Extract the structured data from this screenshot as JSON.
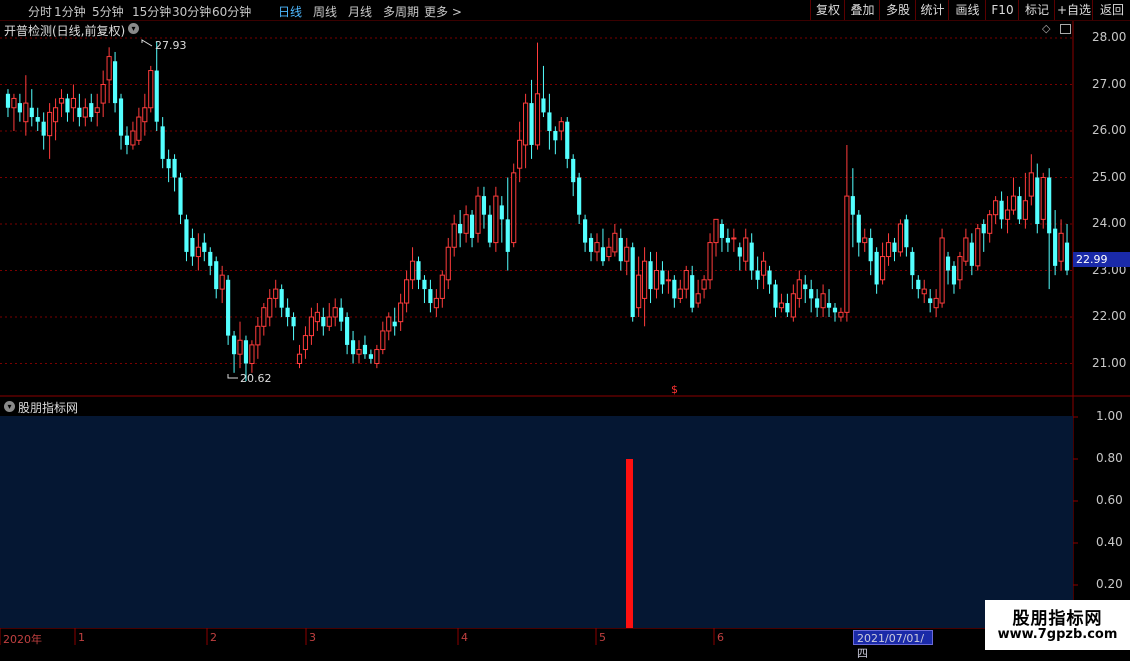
{
  "periods": [
    "分时",
    "1分钟",
    "5分钟",
    "15分钟",
    "30分钟",
    "60分钟",
    "日线",
    "周线",
    "月线",
    "多周期",
    "更多 >"
  ],
  "active_period": "日线",
  "toolbar": [
    "复权",
    "叠加",
    "多股",
    "统计",
    "画线",
    "F10",
    "标记",
    "+自选",
    "返回"
  ],
  "main_title": "开普检测(日线,前复权)",
  "high_label": "27.93",
  "low_label": "20.62",
  "last_price": "22.99",
  "price_axis": [
    "28.00",
    "27.00",
    "26.00",
    "25.00",
    "24.00",
    "23.00",
    "22.00",
    "21.00"
  ],
  "indicator_title": "股朋指标网",
  "indicator_axis": [
    "1.00",
    "0.80",
    "0.60",
    "0.40",
    "0.20"
  ],
  "x_labels": [
    "2020年",
    "1",
    "2",
    "3",
    "4",
    "5",
    "6"
  ],
  "date_box": "2021/07/01/四",
  "marker": "$",
  "watermark": {
    "name": "股朋指标网",
    "url": "www.7gpzb.com"
  },
  "colors": {
    "up": "#ff3c3c",
    "down": "#54ffff",
    "bg": "#000000",
    "panel": "#051733",
    "grid": "#7a0000",
    "signal": "#ff1010"
  },
  "indicator_signal": {
    "value": 0.8
  },
  "chart_data": {
    "type": "candlestick",
    "ylim": [
      20.5,
      28.3
    ],
    "candles": [
      [
        26.8,
        26.5,
        26.9,
        26.3
      ],
      [
        26.5,
        26.7,
        26.8,
        26.0
      ],
      [
        26.6,
        26.4,
        26.8,
        26.2
      ],
      [
        26.2,
        26.6,
        27.2,
        25.9
      ],
      [
        26.5,
        26.3,
        26.9,
        26.1
      ],
      [
        26.3,
        26.2,
        26.5,
        26.0
      ],
      [
        26.2,
        25.9,
        26.4,
        25.6
      ],
      [
        25.9,
        26.4,
        26.6,
        25.4
      ],
      [
        26.2,
        26.5,
        26.7,
        25.8
      ],
      [
        26.6,
        26.7,
        26.9,
        26.3
      ],
      [
        26.7,
        26.4,
        26.8,
        26.2
      ],
      [
        26.5,
        26.7,
        27.0,
        26.2
      ],
      [
        26.5,
        26.3,
        26.8,
        26.1
      ],
      [
        26.3,
        26.5,
        26.7,
        26.1
      ],
      [
        26.6,
        26.3,
        26.8,
        26.2
      ],
      [
        26.4,
        26.5,
        26.8,
        26.1
      ],
      [
        26.6,
        27.0,
        27.3,
        26.3
      ],
      [
        27.1,
        27.6,
        27.8,
        26.6
      ],
      [
        27.5,
        26.6,
        27.7,
        26.4
      ],
      [
        26.7,
        25.9,
        26.8,
        25.6
      ],
      [
        25.9,
        25.7,
        26.1,
        25.5
      ],
      [
        25.7,
        26.0,
        26.2,
        25.6
      ],
      [
        25.8,
        26.3,
        26.5,
        25.7
      ],
      [
        26.2,
        26.5,
        26.8,
        25.9
      ],
      [
        26.5,
        27.3,
        27.4,
        26.4
      ],
      [
        27.3,
        26.2,
        27.93,
        26.0
      ],
      [
        26.1,
        25.4,
        26.3,
        25.2
      ],
      [
        25.4,
        25.2,
        25.6,
        24.9
      ],
      [
        25.4,
        25.0,
        25.5,
        24.7
      ],
      [
        25.0,
        24.2,
        25.1,
        24.0
      ],
      [
        24.1,
        23.4,
        24.2,
        23.2
      ],
      [
        23.7,
        23.3,
        23.9,
        23.1
      ],
      [
        23.3,
        23.5,
        23.8,
        23.0
      ],
      [
        23.6,
        23.4,
        23.8,
        23.2
      ],
      [
        23.4,
        23.1,
        23.5,
        22.9
      ],
      [
        23.2,
        22.6,
        23.3,
        22.4
      ],
      [
        22.6,
        22.9,
        23.1,
        22.3
      ],
      [
        22.8,
        21.6,
        22.9,
        21.4
      ],
      [
        21.6,
        21.2,
        21.7,
        20.8
      ],
      [
        21.2,
        21.5,
        21.9,
        20.9
      ],
      [
        21.5,
        21.0,
        21.6,
        20.62
      ],
      [
        21.0,
        21.4,
        21.5,
        20.8
      ],
      [
        21.4,
        21.8,
        22.0,
        21.1
      ],
      [
        21.8,
        22.2,
        22.3,
        21.6
      ],
      [
        22.0,
        22.4,
        22.6,
        21.8
      ],
      [
        22.4,
        22.6,
        22.8,
        22.2
      ],
      [
        22.6,
        22.2,
        22.7,
        22.0
      ],
      [
        22.2,
        22.0,
        22.4,
        21.8
      ],
      [
        22.0,
        21.8,
        22.1,
        21.5
      ],
      [
        21.0,
        21.2,
        21.4,
        20.9
      ],
      [
        21.3,
        21.6,
        21.8,
        21.1
      ],
      [
        21.6,
        22.0,
        22.2,
        21.4
      ],
      [
        21.9,
        22.1,
        22.3,
        21.7
      ],
      [
        22.0,
        21.8,
        22.2,
        21.6
      ],
      [
        21.8,
        22.0,
        22.3,
        21.7
      ],
      [
        22.0,
        22.2,
        22.4,
        21.8
      ],
      [
        22.2,
        21.9,
        22.4,
        21.7
      ],
      [
        22.0,
        21.4,
        22.1,
        21.2
      ],
      [
        21.5,
        21.2,
        21.7,
        21.0
      ],
      [
        21.2,
        21.3,
        21.5,
        21.0
      ],
      [
        21.4,
        21.2,
        21.6,
        21.1
      ],
      [
        21.2,
        21.1,
        21.3,
        21.0
      ],
      [
        21.0,
        21.3,
        21.4,
        20.9
      ],
      [
        21.3,
        21.7,
        21.9,
        21.2
      ],
      [
        21.7,
        22.0,
        22.1,
        21.5
      ],
      [
        21.9,
        21.8,
        22.2,
        21.6
      ],
      [
        21.9,
        22.3,
        22.5,
        21.7
      ],
      [
        22.3,
        22.8,
        23.0,
        22.1
      ],
      [
        22.8,
        23.2,
        23.5,
        22.6
      ],
      [
        23.2,
        22.8,
        23.3,
        22.6
      ],
      [
        22.8,
        22.6,
        22.9,
        22.3
      ],
      [
        22.6,
        22.3,
        22.8,
        22.1
      ],
      [
        22.2,
        22.4,
        22.6,
        22.0
      ],
      [
        22.4,
        22.9,
        23.0,
        22.2
      ],
      [
        22.8,
        23.5,
        23.7,
        22.6
      ],
      [
        23.5,
        24.0,
        24.2,
        23.3
      ],
      [
        24.0,
        23.8,
        24.3,
        23.5
      ],
      [
        23.8,
        24.2,
        24.4,
        23.6
      ],
      [
        24.2,
        23.7,
        24.3,
        23.5
      ],
      [
        23.8,
        24.6,
        24.8,
        23.6
      ],
      [
        24.6,
        24.2,
        24.8,
        23.9
      ],
      [
        24.2,
        23.6,
        24.4,
        23.5
      ],
      [
        23.6,
        24.6,
        24.8,
        23.4
      ],
      [
        24.4,
        24.1,
        24.6,
        23.6
      ],
      [
        24.1,
        23.4,
        25.0,
        23.0
      ],
      [
        23.6,
        25.1,
        25.3,
        23.5
      ],
      [
        25.2,
        25.8,
        26.2,
        24.9
      ],
      [
        25.7,
        26.6,
        26.8,
        25.2
      ],
      [
        26.6,
        25.7,
        27.1,
        25.4
      ],
      [
        25.7,
        26.8,
        27.9,
        25.6
      ],
      [
        26.7,
        26.4,
        27.4,
        26.3
      ],
      [
        26.4,
        26.0,
        26.8,
        25.6
      ],
      [
        26.0,
        25.8,
        26.1,
        25.5
      ],
      [
        26.0,
        26.2,
        26.3,
        25.8
      ],
      [
        26.2,
        25.4,
        26.3,
        25.2
      ],
      [
        25.4,
        24.9,
        25.5,
        24.6
      ],
      [
        25.0,
        24.2,
        25.1,
        24.0
      ],
      [
        24.1,
        23.6,
        24.2,
        23.4
      ],
      [
        23.7,
        23.4,
        23.8,
        23.2
      ],
      [
        23.4,
        23.6,
        23.8,
        23.2
      ],
      [
        23.5,
        23.2,
        23.9,
        23.1
      ],
      [
        23.3,
        23.5,
        23.7,
        23.2
      ],
      [
        23.4,
        23.8,
        24.0,
        23.3
      ],
      [
        23.7,
        23.2,
        23.9,
        23.0
      ],
      [
        23.2,
        23.5,
        23.7,
        22.9
      ],
      [
        23.5,
        22.0,
        23.6,
        21.9
      ],
      [
        22.2,
        22.9,
        23.3,
        22.0
      ],
      [
        22.4,
        23.2,
        23.5,
        21.8
      ],
      [
        23.2,
        22.6,
        23.4,
        22.3
      ],
      [
        22.6,
        23.0,
        23.4,
        22.4
      ],
      [
        23.0,
        22.7,
        23.2,
        22.5
      ],
      [
        22.8,
        22.8,
        23.0,
        22.5
      ],
      [
        22.8,
        22.4,
        22.9,
        22.2
      ],
      [
        22.4,
        22.6,
        22.8,
        22.3
      ],
      [
        22.6,
        23.0,
        23.1,
        22.4
      ],
      [
        22.9,
        22.2,
        23.1,
        22.1
      ],
      [
        22.3,
        22.5,
        22.8,
        22.2
      ],
      [
        22.6,
        22.8,
        22.9,
        22.4
      ],
      [
        22.8,
        23.6,
        23.8,
        22.6
      ],
      [
        23.6,
        24.1,
        24.1,
        23.3
      ],
      [
        24.0,
        23.7,
        24.1,
        23.4
      ],
      [
        23.7,
        23.6,
        23.9,
        23.4
      ],
      [
        23.7,
        23.7,
        23.9,
        23.4
      ],
      [
        23.5,
        23.3,
        23.6,
        23.0
      ],
      [
        23.2,
        23.7,
        23.9,
        23.0
      ],
      [
        23.6,
        23.0,
        23.8,
        22.8
      ],
      [
        23.0,
        22.8,
        23.3,
        22.6
      ],
      [
        22.9,
        23.2,
        23.4,
        22.6
      ],
      [
        23.0,
        22.7,
        23.1,
        22.5
      ],
      [
        22.7,
        22.2,
        22.8,
        22.0
      ],
      [
        22.2,
        22.3,
        22.5,
        22.1
      ],
      [
        22.3,
        22.1,
        22.5,
        22.0
      ],
      [
        22.0,
        22.5,
        22.7,
        21.9
      ],
      [
        22.4,
        22.8,
        23.0,
        22.2
      ],
      [
        22.7,
        22.6,
        22.9,
        22.3
      ],
      [
        22.6,
        22.4,
        22.8,
        22.1
      ],
      [
        22.4,
        22.2,
        22.6,
        22.0
      ],
      [
        22.2,
        22.5,
        22.7,
        22.0
      ],
      [
        22.3,
        22.2,
        22.6,
        22.0
      ],
      [
        22.2,
        22.1,
        22.3,
        21.9
      ],
      [
        22.0,
        22.1,
        22.2,
        21.9
      ],
      [
        22.1,
        24.6,
        25.7,
        21.9
      ],
      [
        24.6,
        24.2,
        25.2,
        23.5
      ],
      [
        24.2,
        23.6,
        24.3,
        23.3
      ],
      [
        23.6,
        23.7,
        23.9,
        23.4
      ],
      [
        23.7,
        23.2,
        23.9,
        22.9
      ],
      [
        23.4,
        22.7,
        23.5,
        22.5
      ],
      [
        22.8,
        23.3,
        23.6,
        22.7
      ],
      [
        23.3,
        23.6,
        23.8,
        23.1
      ],
      [
        23.6,
        23.4,
        23.7,
        23.2
      ],
      [
        23.4,
        24.0,
        24.1,
        23.3
      ],
      [
        24.1,
        23.5,
        24.2,
        23.3
      ],
      [
        23.4,
        22.9,
        23.5,
        22.6
      ],
      [
        22.8,
        22.6,
        22.9,
        22.4
      ],
      [
        22.5,
        22.6,
        22.8,
        22.3
      ],
      [
        22.4,
        22.3,
        22.6,
        22.1
      ],
      [
        22.2,
        22.4,
        22.6,
        22.0
      ],
      [
        22.3,
        23.7,
        23.9,
        22.2
      ],
      [
        23.3,
        23.0,
        23.4,
        22.7
      ],
      [
        23.1,
        22.7,
        23.2,
        22.5
      ],
      [
        22.8,
        23.3,
        23.4,
        22.6
      ],
      [
        23.2,
        23.7,
        23.9,
        23.1
      ],
      [
        23.6,
        23.1,
        23.8,
        22.9
      ],
      [
        23.1,
        23.9,
        24.0,
        23.0
      ],
      [
        24.0,
        23.8,
        24.1,
        23.4
      ],
      [
        23.8,
        24.2,
        24.3,
        23.6
      ],
      [
        24.2,
        24.5,
        24.6,
        24.0
      ],
      [
        24.5,
        24.1,
        24.7,
        23.9
      ],
      [
        24.1,
        24.3,
        24.6,
        23.8
      ],
      [
        24.3,
        24.6,
        25.0,
        24.2
      ],
      [
        24.6,
        24.1,
        24.8,
        24.0
      ],
      [
        24.1,
        24.5,
        25.1,
        23.9
      ],
      [
        24.6,
        25.1,
        25.5,
        24.4
      ],
      [
        25.0,
        24.0,
        25.3,
        23.8
      ],
      [
        24.1,
        25.0,
        25.1,
        23.9
      ],
      [
        25.0,
        23.8,
        25.2,
        22.6
      ],
      [
        23.9,
        23.1,
        24.3,
        22.9
      ],
      [
        23.2,
        23.8,
        24.1,
        23.0
      ],
      [
        23.6,
        23.0,
        24.0,
        22.9
      ]
    ]
  }
}
